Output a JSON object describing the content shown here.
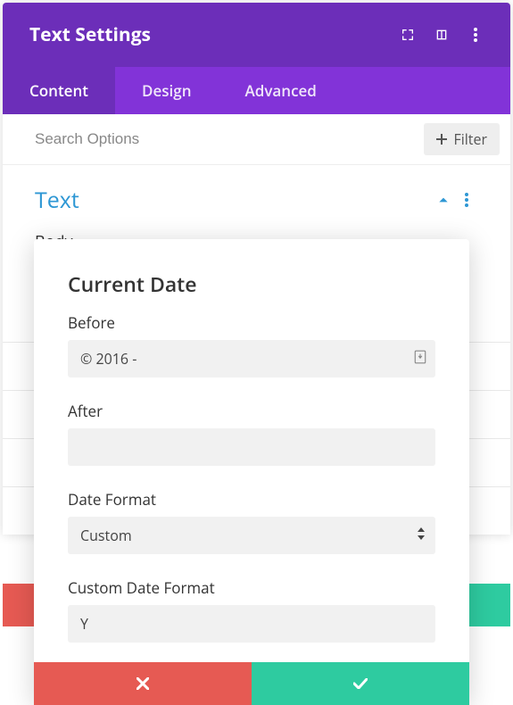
{
  "header": {
    "title": "Text Settings"
  },
  "tabs": {
    "content": "Content",
    "design": "Design",
    "advanced": "Advanced"
  },
  "search": {
    "placeholder": "Search Options",
    "filter_label": "Filter"
  },
  "section": {
    "title": "Text",
    "body_label": "Body"
  },
  "modal": {
    "title": "Current Date",
    "before_label": "Before",
    "before_value": "© 2016 -",
    "after_label": "After",
    "after_value": "",
    "format_label": "Date Format",
    "format_value": "Custom",
    "custom_label": "Custom Date Format",
    "custom_value": "Y"
  }
}
